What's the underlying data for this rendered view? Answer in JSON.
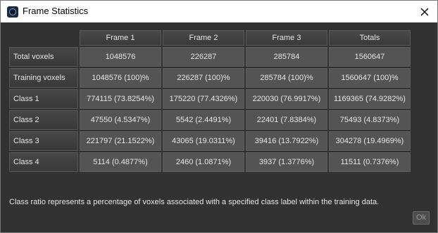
{
  "window": {
    "title": "Frame Statistics"
  },
  "table": {
    "columns": [
      "Frame 1",
      "Frame 2",
      "Frame 3",
      "Totals"
    ],
    "rows": [
      {
        "label": "Total voxels",
        "cells": [
          "1048576",
          "226287",
          "285784",
          "1560647"
        ]
      },
      {
        "label": "Training voxels",
        "cells": [
          "1048576 (100)%",
          "226287 (100)%",
          "285784 (100)%",
          "1560647 (100)%"
        ]
      },
      {
        "label": "Class 1",
        "cells": [
          "774115 (73.8254%)",
          "175220 (77.4326%)",
          "220030 (76.9917%)",
          "1169365 (74.9282%)"
        ]
      },
      {
        "label": "Class 2",
        "cells": [
          "47550 (4.5347%)",
          "5542 (2.4491%)",
          "22401 (7.8384%)",
          "75493 (4.8373%)"
        ]
      },
      {
        "label": "Class 3",
        "cells": [
          "221797 (21.1522%)",
          "43065 (19.0311%)",
          "39416 (13.7922%)",
          "304278 (19.4969%)"
        ]
      },
      {
        "label": "Class 4",
        "cells": [
          "5114 (0.4877%)",
          "2460 (1.0871%)",
          "3937 (1.3776%)",
          "11511 (0.7376%)"
        ]
      }
    ]
  },
  "note": "Class ratio represents a percentage of voxels associated with a specified class label within the training data.",
  "buttons": {
    "ok_label": "Ok"
  },
  "icons": {
    "app": "app-icon",
    "close": "close-icon"
  },
  "colors": {
    "background": "#323232",
    "cell": "#545454",
    "header": "#3f3f3f",
    "text": "#e6e6e6",
    "titlebar": "#ffffff"
  }
}
